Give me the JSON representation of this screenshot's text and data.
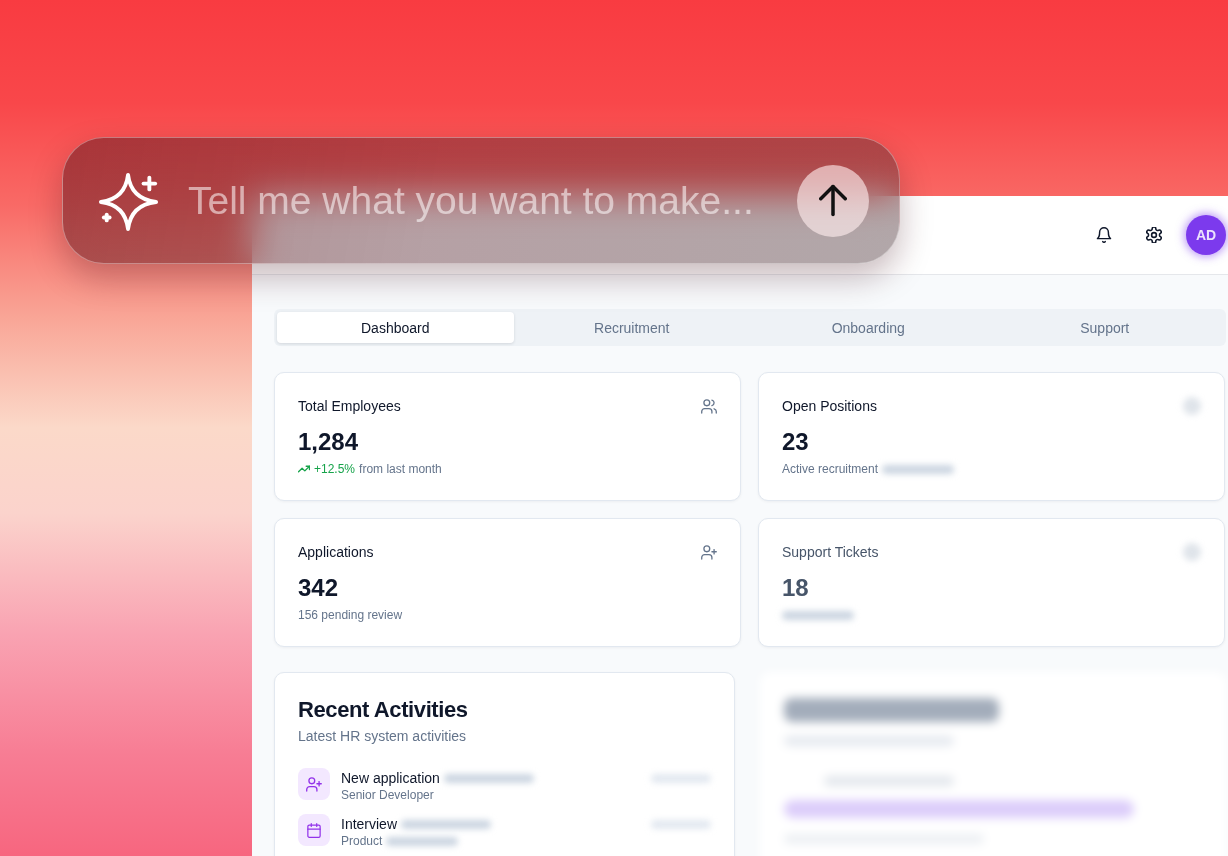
{
  "prompt": {
    "placeholder": "Tell me what you want to make..."
  },
  "header": {
    "avatar": "AD"
  },
  "tabs": [
    {
      "label": "Dashboard",
      "selected": true
    },
    {
      "label": "Recruitment",
      "selected": false
    },
    {
      "label": "Onboarding",
      "selected": false
    },
    {
      "label": "Support",
      "selected": false
    }
  ],
  "stats": [
    {
      "title": "Total Employees",
      "value": "1,284",
      "faded": false,
      "change": {
        "value": "+12.5%",
        "caption": "from last month"
      },
      "note_blurred_tail": false
    },
    {
      "title": "Open Positions",
      "value": "23",
      "faded": false,
      "note": "Active recruitment",
      "note_blurred_tail": true
    },
    {
      "title": "Applications",
      "value": "342",
      "faded": false,
      "note": "156 pending review",
      "note_blurred_tail": false
    },
    {
      "title": "Support Tickets",
      "value": "18",
      "faded": true,
      "note_blurred_tail": true
    }
  ],
  "activities": {
    "title": "Recent Activities",
    "subtitle": "Latest HR system activities",
    "items": [
      {
        "title": "New application",
        "title_blurred_tail": true,
        "subtitle": "Senior Developer",
        "subtitle_blurred_tail": false
      },
      {
        "title": "Interview",
        "title_blurred_tail": true,
        "subtitle": "Product",
        "subtitle_blurred_tail": true
      }
    ]
  }
}
